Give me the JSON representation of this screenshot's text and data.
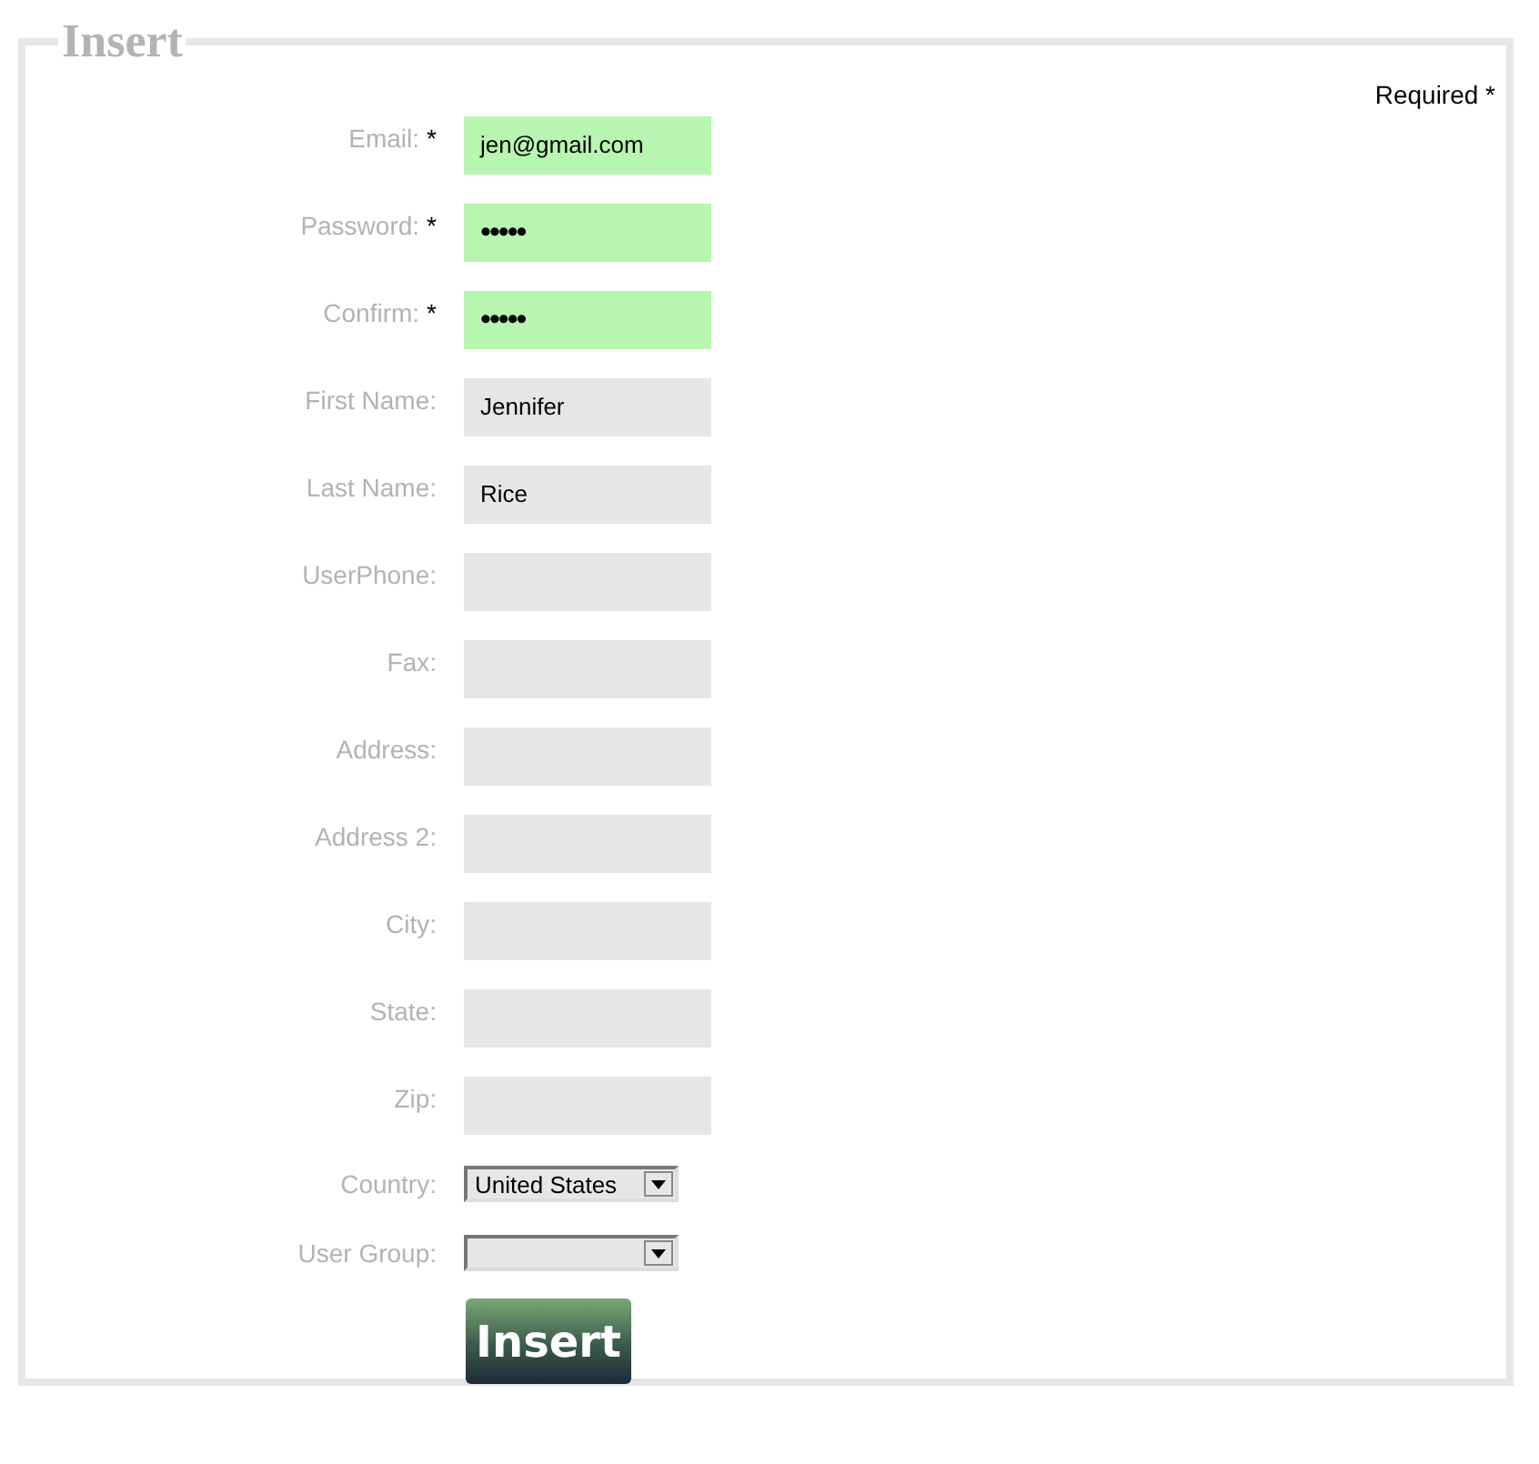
{
  "form": {
    "legend": "Insert",
    "required_note": "Required *",
    "fields": [
      {
        "kind": "text",
        "label": "Email:",
        "mark": "*",
        "required": true,
        "value": "jen@gmail.com"
      },
      {
        "kind": "password",
        "label": "Password:",
        "mark": "*",
        "required": true,
        "value": "•••••"
      },
      {
        "kind": "password",
        "label": "Confirm:",
        "mark": "*",
        "required": true,
        "value": "•••••"
      },
      {
        "kind": "text",
        "label": "First Name:",
        "required": false,
        "value": "Jennifer"
      },
      {
        "kind": "text",
        "label": "Last Name:",
        "required": false,
        "value": "Rice"
      },
      {
        "kind": "text",
        "label": "UserPhone:",
        "required": false
      },
      {
        "kind": "text",
        "label": "Fax:",
        "required": false
      },
      {
        "kind": "text",
        "label": "Address:",
        "required": false
      },
      {
        "kind": "text",
        "label": "Address 2:",
        "required": false
      },
      {
        "kind": "text",
        "label": "City:",
        "required": false
      },
      {
        "kind": "text",
        "label": "State:",
        "required": false
      },
      {
        "kind": "text",
        "label": "Zip:",
        "required": false
      },
      {
        "kind": "select",
        "label": "Country:",
        "required": false,
        "value": "United States"
      },
      {
        "kind": "select",
        "label": "User Group:",
        "required": false
      }
    ],
    "submit": "Insert"
  }
}
